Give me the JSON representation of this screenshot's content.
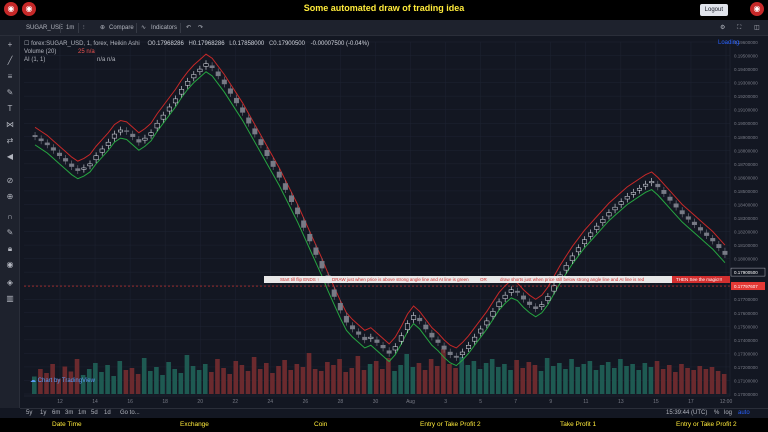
{
  "banner": {
    "title": "Some automated draw of trading idea",
    "logout_label": "Logout"
  },
  "toolbar": {
    "symbol": "SUGAR_USE",
    "interval": "1m",
    "compare_label": "Compare",
    "indicators_label": "Indicators",
    "loading_label": "Loading"
  },
  "legend": {
    "main_label": "forex:SUGAR_USD, 1, forex, Heikin Ashi",
    "o_label": "O",
    "o_value": "0.17968286",
    "h_label": "H",
    "h_value": "0.17968286",
    "l_label": "L",
    "l_value": "0.17858000",
    "c_label": "C",
    "c_value": "0.17900500",
    "change": "-0.00007500 (-0.04%)",
    "volume_label": "Volume (20)",
    "volume_values": "25 n/a",
    "ai_label": "AI (1, 1)",
    "ai_values": "n/a n/a"
  },
  "price_axis": {
    "labels": [
      "0.19600000",
      "0.19500000",
      "0.19400000",
      "0.19300000",
      "0.19200000",
      "0.19100000",
      "0.19000000",
      "0.18900000",
      "0.18800000",
      "0.18700000",
      "0.18600000",
      "0.18500000",
      "0.18400000",
      "0.18300000",
      "0.18200000",
      "0.18100000",
      "0.18000000",
      "0.17900000",
      "0.17800000",
      "0.17700000",
      "0.17600000",
      "0.17500000",
      "0.17400000",
      "0.17300000",
      "0.17200000",
      "0.17100000",
      "0.17000000"
    ],
    "current_price_label": "0.17900500",
    "line_price_label": "0.17797607",
    "current_price_color": "#ffffff",
    "line_price_color": "#e53935"
  },
  "time_axis": {
    "labels": [
      "12",
      "14",
      "16",
      "18",
      "20",
      "22",
      "24",
      "26",
      "28",
      "30",
      "Aug",
      "3",
      "5",
      "7",
      "9",
      "11",
      "13",
      "15",
      "17",
      "12:00"
    ],
    "timezone": "15:39:44 (UTC)",
    "pct_label": "%",
    "log_label": "log",
    "auto_label": "auto"
  },
  "timeframes": [
    "5y",
    "1y",
    "6m",
    "3m",
    "1m",
    "5d",
    "1d",
    "Go to..."
  ],
  "watermark": "Chart by TradingView",
  "annotations": [
    {
      "text": "Start till flip ENDS ↑"
    },
    {
      "text": "DRAW just when   price is above strong angle line and AI line is green"
    },
    {
      "text": "OR"
    },
    {
      "text": "draw shorts just when price still below strong angle line and AI line is red"
    },
    {
      "text": "THEN See the magic!!!"
    }
  ],
  "footer": [
    "Date Time",
    "Exchange",
    "Coin",
    "Entry or Take Profit 2",
    "Take Profit 1",
    "Entry or Take Profit 2"
  ],
  "colors": {
    "up": "#26a69a",
    "down": "#ef5350",
    "bg": "#131722",
    "accent": "#ffeb3b",
    "ai_green": "#26a641",
    "ai_red": "#c62828"
  },
  "chart_data": {
    "type": "candlestick",
    "y_range": [
      0.17,
      0.196
    ],
    "closes": [
      0.189,
      0.1887,
      0.1884,
      0.188,
      0.1876,
      0.1872,
      0.1868,
      0.1865,
      0.1867,
      0.187,
      0.1876,
      0.1881,
      0.1886,
      0.1892,
      0.1895,
      0.1894,
      0.189,
      0.1886,
      0.1889,
      0.1893,
      0.19,
      0.1906,
      0.1912,
      0.1918,
      0.1925,
      0.1931,
      0.1936,
      0.194,
      0.1944,
      0.1941,
      0.1935,
      0.1929,
      0.1922,
      0.1915,
      0.1908,
      0.19,
      0.1892,
      0.1884,
      0.1876,
      0.1868,
      0.186,
      0.1851,
      0.1842,
      0.1833,
      0.1823,
      0.1813,
      0.1803,
      0.1793,
      0.1782,
      0.1772,
      0.1762,
      0.1753,
      0.1748,
      0.1744,
      0.174,
      0.1742,
      0.1738,
      0.1734,
      0.173,
      0.1735,
      0.1743,
      0.1752,
      0.1758,
      0.1754,
      0.1748,
      0.1742,
      0.1738,
      0.1733,
      0.1729,
      0.1727,
      0.1731,
      0.1736,
      0.1742,
      0.1748,
      0.1754,
      0.1761,
      0.1768,
      0.1773,
      0.1777,
      0.1775,
      0.177,
      0.1766,
      0.1763,
      0.1766,
      0.1772,
      0.178,
      0.1788,
      0.1795,
      0.1802,
      0.1808,
      0.1814,
      0.1819,
      0.1824,
      0.1829,
      0.1834,
      0.1838,
      0.1842,
      0.1846,
      0.1849,
      0.1852,
      0.1855,
      0.1857,
      0.1853,
      0.1848,
      0.1843,
      0.1838,
      0.1833,
      0.1829,
      0.1825,
      0.1821,
      0.1817,
      0.1813,
      0.1808,
      0.1803
    ],
    "volumes": [
      0.35,
      0.5,
      0.42,
      0.6,
      0.3,
      0.55,
      0.45,
      0.7,
      0.38,
      0.5,
      0.62,
      0.44,
      0.58,
      0.36,
      0.66,
      0.48,
      0.52,
      0.4,
      0.72,
      0.46,
      0.54,
      0.38,
      0.64,
      0.5,
      0.42,
      0.78,
      0.56,
      0.48,
      0.6,
      0.44,
      0.7,
      0.52,
      0.4,
      0.66,
      0.58,
      0.46,
      0.74,
      0.5,
      0.62,
      0.42,
      0.56,
      0.68,
      0.48,
      0.6,
      0.54,
      0.82,
      0.5,
      0.46,
      0.64,
      0.58,
      0.7,
      0.44,
      0.52,
      0.76,
      0.48,
      0.6,
      0.66,
      0.5,
      0.72,
      0.46,
      0.58,
      0.8,
      0.54,
      0.62,
      0.48,
      0.7,
      0.56,
      0.9,
      0.6,
      0.52,
      0.74,
      0.58,
      0.66,
      0.5,
      0.62,
      0.7,
      0.54,
      0.6,
      0.48,
      0.68,
      0.52,
      0.64,
      0.58,
      0.46,
      0.72,
      0.56,
      0.62,
      0.5,
      0.7,
      0.54,
      0.6,
      0.66,
      0.48,
      0.58,
      0.64,
      0.52,
      0.7,
      0.56,
      0.6,
      0.48,
      0.62,
      0.54,
      0.66,
      0.5,
      0.58,
      0.44,
      0.6,
      0.52,
      0.48,
      0.56,
      0.5,
      0.54,
      0.46,
      0.4
    ]
  }
}
